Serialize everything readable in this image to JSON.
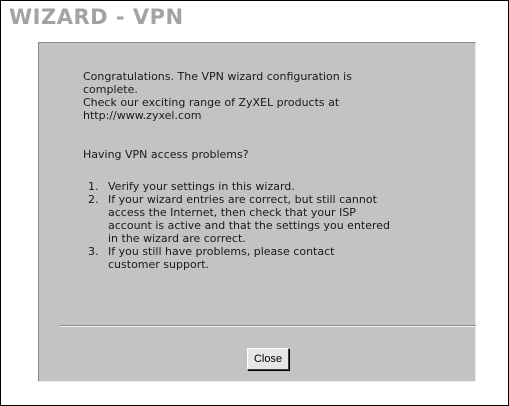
{
  "window": {
    "title": "WIZARD - VPN"
  },
  "panel": {
    "congrats_lines": [
      "Congratulations. The VPN wizard configuration is",
      "complete.",
      "Check our exciting range of ZyXEL products at",
      "http://www.zyxel.com"
    ],
    "question": "Having VPN access problems?",
    "steps": [
      {
        "number": "1.",
        "lines": [
          "Verify your settings in this wizard."
        ]
      },
      {
        "number": "2.",
        "lines": [
          "If your wizard entries are correct, but still cannot",
          "access the Internet, then check that your ISP",
          "account is active and that the settings you entered",
          "in the wizard are correct."
        ]
      },
      {
        "number": "3.",
        "lines": [
          "If you still have problems, please contact",
          "customer support."
        ]
      }
    ]
  },
  "buttons": {
    "close_label": "Close"
  }
}
